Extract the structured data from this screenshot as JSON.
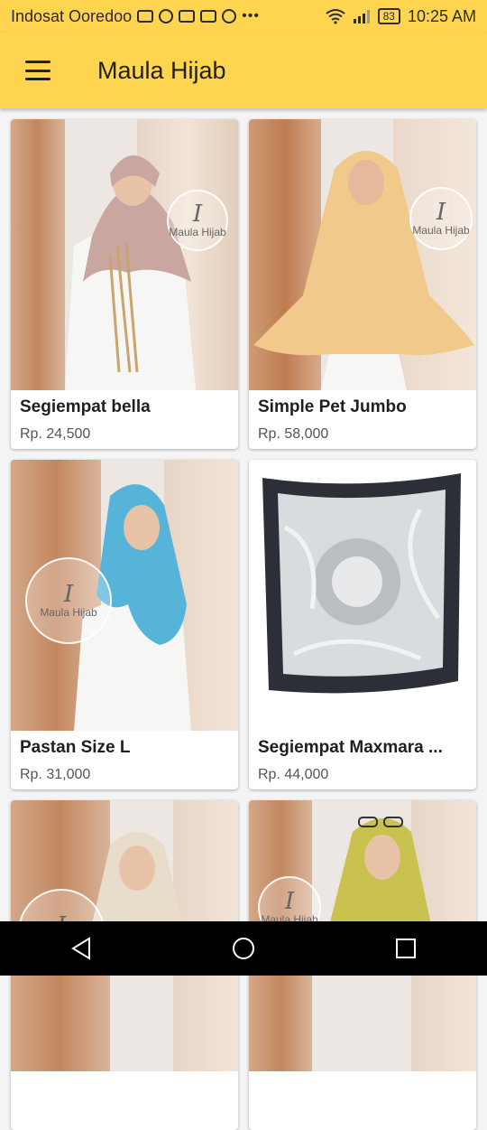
{
  "status_bar": {
    "carrier": "Indosat Ooredoo",
    "battery": "83",
    "time": "10:25 AM"
  },
  "app_bar": {
    "title": "Maula Hijab"
  },
  "watermark": {
    "script": "I",
    "text": "Maula Hijab"
  },
  "products": [
    {
      "name": "Segiempat bella",
      "price": "Rp. 24,500"
    },
    {
      "name": "Simple Pet Jumbo",
      "price": "Rp. 58,000"
    },
    {
      "name": "Pastan Size L",
      "price": "Rp. 31,000"
    },
    {
      "name": "Segiempat Maxmara ...",
      "price": "Rp. 44,000"
    },
    {
      "name": "",
      "price": ""
    },
    {
      "name": "",
      "price": ""
    }
  ],
  "colors": {
    "accent": "#ffd54f",
    "scarf_1": "#c9a7a0",
    "scarf_2": "#f1c98a",
    "scarf_3": "#56b4d9",
    "scarf_5": "#e8dccb",
    "scarf_6": "#c9c24e"
  }
}
